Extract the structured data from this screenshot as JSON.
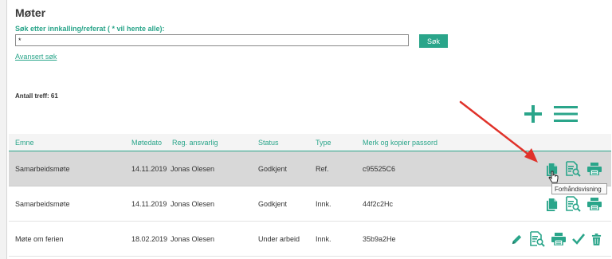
{
  "page": {
    "title": "Møter",
    "search_label": "Søk etter innkalling/referat ( * vil hente alle):",
    "search_value": "*",
    "search_button": "Søk",
    "advanced_link": "Avansert søk",
    "hits_label": "Antall treff: 61"
  },
  "colors": {
    "accent": "#2aa58a",
    "arrow": "#e0322a",
    "selected_row": "#d8d8d8"
  },
  "table": {
    "headers": {
      "emne": "Emne",
      "dato": "Møtedato",
      "reg": "Reg. ansvarlig",
      "status": "Status",
      "type": "Type",
      "pass": "Merk og kopier passord"
    },
    "rows": [
      {
        "emne": "Samarbeidsmøte",
        "dato": "14.11.2019",
        "reg": "Jonas Olesen",
        "status": "Godkjent",
        "type": "Ref.",
        "pass": "c95525C6",
        "icons": [
          "copy-icon",
          "preview-icon",
          "print-icon"
        ]
      },
      {
        "emne": "Samarbeidsmøte",
        "dato": "14.11.2019",
        "reg": "Jonas Olesen",
        "status": "Godkjent",
        "type": "Innk.",
        "pass": "44f2c2Hc",
        "icons": [
          "copy-icon",
          "preview-icon",
          "print-icon"
        ]
      },
      {
        "emne": "Møte om ferien",
        "dato": "18.02.2019",
        "reg": "Jonas Olesen",
        "status": "Under arbeid",
        "type": "Innk.",
        "pass": "35b9a2He",
        "icons": [
          "edit-icon",
          "preview-icon",
          "print-icon",
          "check-icon",
          "trash-icon"
        ]
      }
    ]
  },
  "tooltip": "Forhåndsvisning"
}
